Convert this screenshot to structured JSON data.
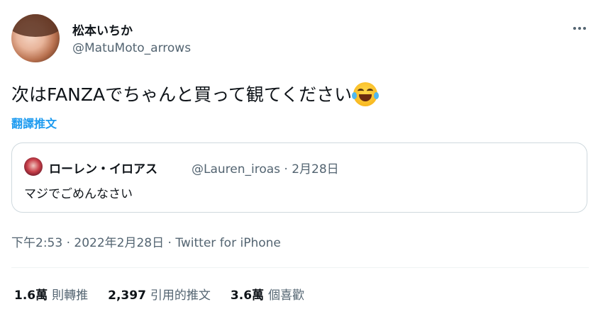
{
  "author": {
    "display_name": "松本いちか",
    "handle": "@MatuMoto_arrows"
  },
  "more_icon": "more-horizontal-icon",
  "tweet": {
    "text": "次はFANZAでちゃんと買って観てください",
    "emoji": "face-with-tears-of-joy",
    "translate_label": "翻譯推文"
  },
  "quote": {
    "display_name": "ローレン・イロアス",
    "handle_and_date": "@Lauren_iroas · 2月28日",
    "text": "マジでごめんなさい"
  },
  "meta": {
    "time_date": "下午2:53 · 2022年2月28日 · ",
    "source": "Twitter for iPhone"
  },
  "stats": {
    "retweets_count": "1.6萬",
    "retweets_label": "則轉推",
    "quotes_count": "2,397",
    "quotes_label": "引用的推文",
    "likes_count": "3.6萬",
    "likes_label": "個喜歡"
  },
  "colors": {
    "link": "#1d9bf0",
    "text": "#0f1419",
    "secondary": "#536471",
    "border": "#cfd9de"
  }
}
